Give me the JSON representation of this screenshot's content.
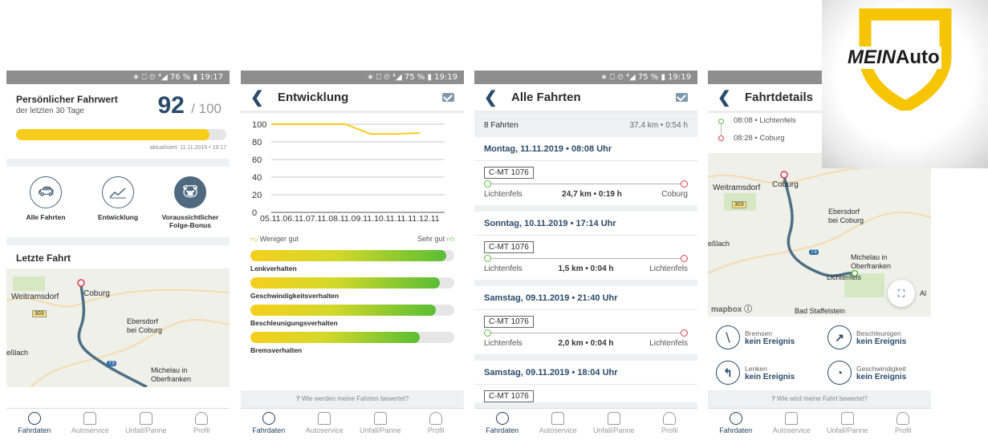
{
  "status": {
    "p1": "∗ ⎕ ⏲ ⁴◢ 76 % ▮ 19:17",
    "p2": "∗ ⎕ ⏲ ⁴◢ 75 % ▮ 19:19",
    "p3": "∗ ⎕ ⏲ ⁴◢ 75 % ▮ 19:19",
    "p4": "∗ ⎕"
  },
  "tabs": [
    "Fahrdaten",
    "Autoservice",
    "Unfall/Panne",
    "Profil"
  ],
  "colors": {
    "accent": "#f8cc1b",
    "navy": "#2a4a6b",
    "route": "#4f6f85",
    "green": "#5bbd3c",
    "red": "#e53945"
  },
  "p1": {
    "title": "Persönlicher Fahrwert",
    "subtitle": "der letzten 30 Tage",
    "score": "92",
    "score_max": "/ 100",
    "score_fraction": 0.92,
    "updated": "aktualisiert: 11.11.2019 • 19:17",
    "actions": [
      {
        "label": "Alle Fahrten",
        "icon": "car-icon"
      },
      {
        "label": "Entwicklung",
        "icon": "trend-icon"
      },
      {
        "label": "Voraussichtlicher Folge-Bonus",
        "icon": "piggy-bank-icon"
      }
    ],
    "last_trip": "Letzte Fahrt",
    "map_labels": [
      "Weitramsdorf",
      "Coburg",
      "Ebersdorf",
      "bei Coburg",
      "eßlach",
      "Michelau in",
      "Oberfranken",
      "303",
      "73"
    ]
  },
  "p2": {
    "title": "Entwicklung",
    "chart_data": {
      "type": "line",
      "x": [
        "05.11.",
        "06.11.",
        "07.11.",
        "08.11.",
        "09.11.",
        "10.11.",
        "11.11.",
        "12.11"
      ],
      "y_ticks": [
        "100",
        "80",
        "60",
        "40",
        "20",
        "0"
      ],
      "ylim": [
        0,
        100
      ],
      "series": [
        {
          "points": [
            [
              0,
              100
            ],
            [
              1,
              100
            ],
            [
              2,
              100
            ],
            [
              3,
              100
            ],
            [
              4,
              89
            ],
            [
              5,
              89
            ],
            [
              6,
              90
            ]
          ]
        }
      ]
    },
    "less_good": "Weniger gut",
    "very_good": "Sehr gut",
    "bars": [
      {
        "label": "Lenkverhalten",
        "value": 0.96
      },
      {
        "label": "Geschwindigkeitsverhalten",
        "value": 0.93
      },
      {
        "label": "Beschleunigungsverhalten",
        "value": 0.91
      },
      {
        "label": "Bremsverhalten",
        "value": 0.83
      }
    ],
    "help": "Wie werden meine Fahrten bewertet?"
  },
  "p3": {
    "title": "Alle Fahrten",
    "count": "8 Fahrten",
    "total": "37,4 km • 0:54 h",
    "trips": [
      {
        "date": "Montag, 11.11.2019 • 08:08 Uhr",
        "plate": "C-MT 1076",
        "from": "Lichtenfels",
        "stats": "24,7 km • 0:19 h",
        "to": "Coburg"
      },
      {
        "date": "Sonntag, 10.11.2019 • 17:14 Uhr",
        "plate": "C-MT 1076",
        "from": "Lichtenfels",
        "stats": "1,5 km • 0:04 h",
        "to": "Lichtenfels"
      },
      {
        "date": "Samstag, 09.11.2019 • 21:40 Uhr",
        "plate": "C-MT 1076",
        "from": "Lichtenfels",
        "stats": "2,0 km • 0:04 h",
        "to": "Lichtenfels"
      },
      {
        "date": "Samstag, 09.11.2019 • 18:04 Uhr",
        "plate": "C-MT 1076"
      }
    ]
  },
  "p4": {
    "title": "Fahrtdetails",
    "start": "08:08 • Lichtenfels",
    "end": "08:28 • Coburg",
    "map_labels": [
      "Weitramsdorf",
      "Coburg",
      "Ebersdorf",
      "bei Coburg",
      "eßlach",
      "Michelau in",
      "Oberfranken",
      "Lichtenfels",
      "Bad Staffelstein",
      "303",
      "73",
      "Al"
    ],
    "mapbox": "mapbox",
    "events": [
      {
        "name": "Bremsen",
        "value": "kein Ereignis",
        "icon": "brake-icon"
      },
      {
        "name": "Beschleunigen",
        "value": "kein Ereignis",
        "icon": "accelerate-icon"
      },
      {
        "name": "Lenken",
        "value": "kein Ereignis",
        "icon": "steering-icon"
      },
      {
        "name": "Geschwindigkeit",
        "value": "kein Ereignis",
        "icon": "speedometer-icon"
      }
    ],
    "help": "Wie wird meine Fahrt bewertet?"
  },
  "logo": {
    "text_a": "MEIN",
    "text_b": "Auto"
  }
}
